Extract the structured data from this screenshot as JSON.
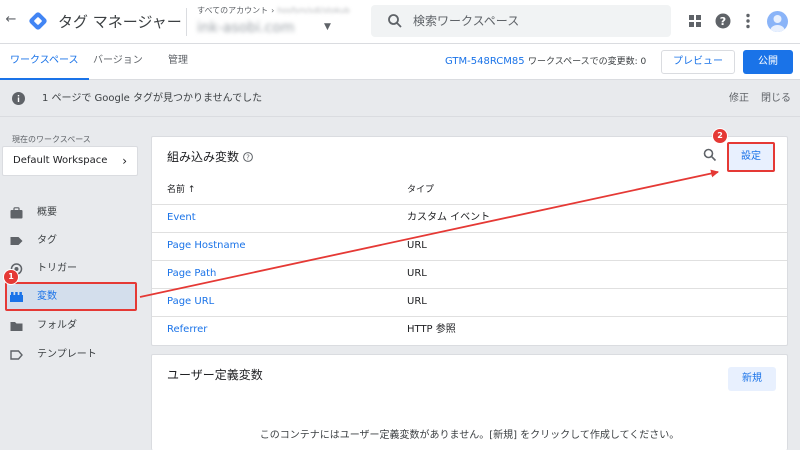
{
  "header": {
    "app_title": "タグ マネージャー",
    "account_breadcrumb": "すべてのアカウント",
    "account_blurred_small": "hosfsm/sdl/stokub",
    "account_blurred_main": "ink-asobi.com",
    "search_placeholder": "検索ワークスペース"
  },
  "tabs": [
    {
      "label": "ワークスペース",
      "active": true
    },
    {
      "label": "バージョン",
      "active": false
    },
    {
      "label": "管理",
      "active": false
    }
  ],
  "status": {
    "container_id": "GTM-548RCM85",
    "change_count": "ワークスペースでの変更数: 0"
  },
  "actions": {
    "preview": "プレビュー",
    "publish": "公開"
  },
  "infobar": {
    "message": "1 ページで Google タグが見つかりませんでした",
    "fix": "修正",
    "close": "閉じる"
  },
  "sidebar": {
    "workspace_label": "現在のワークスペース",
    "workspace_name": "Default Workspace",
    "items": [
      {
        "label": "概要",
        "icon": "briefcase-icon"
      },
      {
        "label": "タグ",
        "icon": "tag-icon"
      },
      {
        "label": "トリガー",
        "icon": "trigger-icon"
      },
      {
        "label": "変数",
        "icon": "variables-icon",
        "active": true
      },
      {
        "label": "フォルダ",
        "icon": "folder-icon"
      },
      {
        "label": "テンプレート",
        "icon": "template-icon"
      }
    ]
  },
  "builtin": {
    "title": "組み込み変数",
    "configure": "設定",
    "col_name": "名前 ↑",
    "col_type": "タイプ",
    "rows": [
      {
        "name": "Event",
        "type": "カスタム イベント"
      },
      {
        "name": "Page Hostname",
        "type": "URL"
      },
      {
        "name": "Page Path",
        "type": "URL"
      },
      {
        "name": "Page URL",
        "type": "URL"
      },
      {
        "name": "Referrer",
        "type": "HTTP 参照"
      }
    ]
  },
  "user_vars": {
    "title": "ユーザー定義変数",
    "new": "新規",
    "empty_message": "このコンテナにはユーザー定義変数がありません。[新規] をクリックして作成してください。"
  },
  "annotations": {
    "badge1": "1",
    "badge2": "2",
    "color": "#e53935"
  },
  "colors": {
    "accent": "#1a73e8",
    "annotation": "#e53935"
  }
}
